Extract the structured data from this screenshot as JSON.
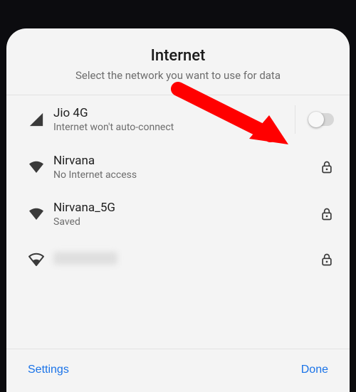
{
  "header": {
    "title": "Internet",
    "subtitle": "Select the network you want to use for data"
  },
  "networks": [
    {
      "name": "Jio 4G",
      "detail": "Internet won't auto-connect",
      "signal": "cellular",
      "secure": false,
      "toggle": true
    },
    {
      "name": "Nirvana",
      "detail": "No Internet access",
      "signal": "wifi-full",
      "secure": true,
      "toggle": false
    },
    {
      "name": "Nirvana_5G",
      "detail": "Saved",
      "signal": "wifi-full",
      "secure": true,
      "toggle": false
    },
    {
      "name": "██████",
      "detail": "",
      "signal": "wifi-outline",
      "secure": true,
      "toggle": false,
      "redacted": true
    }
  ],
  "footer": {
    "settings": "Settings",
    "done": "Done"
  },
  "colors": {
    "accent": "#1a73e8",
    "pointer": "#ff0000"
  }
}
